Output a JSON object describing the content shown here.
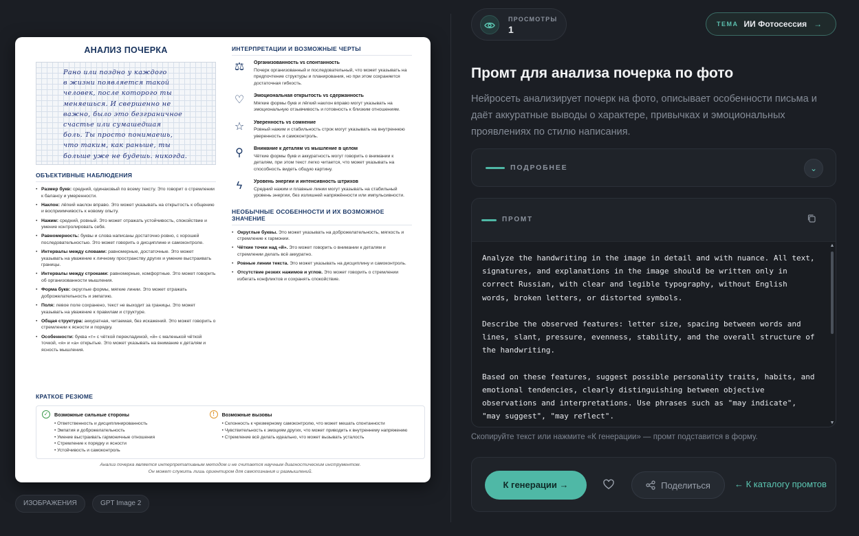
{
  "preview": {
    "title": "АНАЛИЗ ПОЧЕРКА",
    "handwriting_lines": [
      "Рано или поздно у каждого",
      "в жизни появляется такой",
      "человек, после которого ты",
      "меняешься. И свершенно не",
      "важно, было это безграничное",
      "счастье или сумашедшая",
      "боль. Ты просто понимаешь,",
      "что таким, как раньше, ты",
      "больше уже не будешь. никогда."
    ],
    "observations_title": "ОБЪЕКТИВНЫЕ НАБЛЮДЕНИЯ",
    "observations": [
      {
        "label": "Размер букв:",
        "text": "средний, одинаковый по всему тексту. Это говорит о стремлении к балансу и умеренности."
      },
      {
        "label": "Наклон:",
        "text": "лёгкий наклон вправо. Это может указывать на открытость к общению и восприимчивость к новому опыту."
      },
      {
        "label": "Нажим:",
        "text": "средний, ровный. Это может отражать устойчивость, спокойствие и умение контролировать себя."
      },
      {
        "label": "Равномерность:",
        "text": "буквы и слова написаны достаточно ровно, с хорошей последовательностью. Это может говорить о дисциплине и самоконтроле."
      },
      {
        "label": "Интервалы между словами:",
        "text": "равномерные, достаточные. Это может указывать на уважение к личному пространству других и умение выстраивать границы."
      },
      {
        "label": "Интервалы между строками:",
        "text": "равномерные, комфортные. Это может говорить об организованности мышления."
      },
      {
        "label": "Форма букв:",
        "text": "округлые формы, мягкие линии. Это может отражать доброжелательность и эмпатию."
      },
      {
        "label": "Поля:",
        "text": "левое поле сохранено, текст не выходит за границы. Это может указывать на уважение к правилам и структуре."
      },
      {
        "label": "Общая структура:",
        "text": "аккуратная, читаемая, без искажений. Это может говорить о стремлении к ясности и порядку."
      },
      {
        "label": "Особенности:",
        "text": "буква «т» с чёткой перекладиной, «й» с маленькой чёткой точкой, «я» и «а» открытые. Это может указывать на внимание к деталям и ясность мышления."
      }
    ],
    "interpretations_title": "ИНТЕРПРЕТАЦИИ И ВОЗМОЖНЫЕ ЧЕРТЫ",
    "interpretations": [
      {
        "icon": "scales-icon",
        "glyph": "⚖",
        "title": "Организованность vs спонтанность",
        "text": "Почерк организованный и последовательный, что может указывать на предпочтение структуры и планирования, но при этом сохраняется достаточная гибкость."
      },
      {
        "icon": "heart-icon",
        "glyph": "♡",
        "title": "Эмоциональная открытость vs сдержанность",
        "text": "Мягкие формы букв и лёгкий наклон вправо могут указывать на эмоциональную отзывчивость и готовность к близким отношениям."
      },
      {
        "icon": "star-icon",
        "glyph": "☆",
        "title": "Уверенность vs сомнение",
        "text": "Ровный нажим и стабильность строк могут указывать на внутреннюю уверенность и самоконтроль."
      },
      {
        "icon": "magnifier-icon",
        "glyph": "⚲",
        "title": "Внимание к деталям vs мышление в целом",
        "text": "Чёткие формы букв и аккуратность могут говорить о внимании к деталям, при этом текст легко читается, что может указывать на способность видеть общую картину."
      },
      {
        "icon": "lightning-icon",
        "glyph": "ϟ",
        "title": "Уровень энергии и интенсивность штрихов",
        "text": "Средний нажим и плавные линии могут указывать на стабильный уровень энергии, без излишней напряжённости или импульсивности."
      }
    ],
    "unusual_title": "НЕОБЫЧНЫЕ ОСОБЕННОСТИ И ИХ ВОЗМОЖНОЕ ЗНАЧЕНИЕ",
    "unusual": [
      {
        "label": "Округлые буквы.",
        "text": "Это может указывать на доброжелательность, мягкость и стремление к гармонии."
      },
      {
        "label": "Чёткие точки над «й».",
        "text": "Это может говорить о внимании к деталям и стремлении делать всё аккуратно."
      },
      {
        "label": "Ровные линии текста.",
        "text": "Это может указывать на дисциплину и самоконтроль."
      },
      {
        "label": "Отсутствие резких нажимов и углов.",
        "text": "Это может говорить о стремлении избегать конфликтов и сохранять спокойствие."
      }
    ],
    "resume_title": "КРАТКОЕ РЕЗЮМЕ",
    "strengths_title": "Возможные сильные стороны",
    "strengths": [
      "Ответственность и дисциплинированность",
      "Эмпатия и доброжелательность",
      "Умение выстраивать гармоничные отношения",
      "Стремление к порядку и ясности",
      "Устойчивость и самоконтроль"
    ],
    "challenges_title": "Возможные вызовы",
    "challenges": [
      "Склонность к чрезмерному самоконтролю, что может мешать спонтанности",
      "Чувствительность к эмоциям других, что может приводить к внутреннему напряжению",
      "Стремление всё делать идеально, что может вызывать усталость"
    ],
    "disclaimer_1": "Анализ почерка является интерпретативным методом и не считается научным диагностическим инструментом.",
    "disclaimer_2": "Он может служить лишь ориентиром для самопознания и размышлений."
  },
  "tags": [
    "ИЗОБРАЖЕНИЯ",
    "GPT Image 2"
  ],
  "views": {
    "label": "ПРОСМОТРЫ",
    "count": "1"
  },
  "topic": {
    "label": "ТЕМА",
    "value": "ИИ Фотосессия",
    "arrow": "→"
  },
  "page_title": "Промт для анализа почерка по фото",
  "page_description": "Нейросеть анализирует почерк на фото, описывает особенности письма и даёт аккуратные выводы о характере, привычках и эмоциональных проявлениях по стилю написания.",
  "details": {
    "label": "ПОДРОБНЕЕ",
    "chevron": "⌄"
  },
  "prompt": {
    "label": "ПРОМТ",
    "text": "Analyze the handwriting in the image in detail and with nuance. All text, signatures, and explanations in the image should be written only in correct Russian, with clear and legible typography, without English words, broken letters, or distorted symbols.\n\nDescribe the observed features: letter size, spacing between words and lines, slant, pressure, evenness, stability, and the overall structure of the handwriting.\n\nBased on these features, suggest possible personality traits, habits, and emotional tendencies, clearly distinguishing between objective observations and interpretations. Use phrases such as \"may indicate\", \"may suggest\", \"may reflect\"."
  },
  "hint": "Скопируйте текст или нажмите «К генерации» — промт подставится в форму.",
  "actions": {
    "generate_label": "К генерации →",
    "share_label": "Поделиться",
    "catalog_label": "← К каталогу промтов"
  },
  "colors": {
    "accent": "#4fb8a6",
    "background": "#1b1e24",
    "card": "#1f2329"
  }
}
